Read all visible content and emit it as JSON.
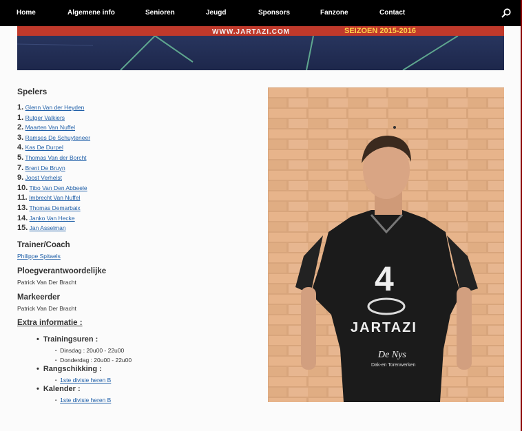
{
  "nav": {
    "items": [
      "Home",
      "Algemene info",
      "Senioren",
      "Jeugd",
      "Sponsors",
      "Fanzone",
      "Contact"
    ],
    "search_icon": "search-icon"
  },
  "banner": {
    "url": "WWW.JARTAZI.COM",
    "season": "SEIZOEN 2015-2016"
  },
  "players": {
    "heading": "Spelers",
    "list": [
      {
        "num": "1.",
        "name": "Glenn Van der Heyden"
      },
      {
        "num": "1.",
        "name": "Rutger Valkiers"
      },
      {
        "num": "2.",
        "name": "Maarten Van Nuffel"
      },
      {
        "num": "3.",
        "name": "Ramses De Schuyteneer"
      },
      {
        "num": "4.",
        "name": "Kas De Durpel"
      },
      {
        "num": "5.",
        "name": "Thomas Van der Borcht"
      },
      {
        "num": "7.",
        "name": "Brent De Bruyn"
      },
      {
        "num": "9.",
        "name": "Joost Verhelst"
      },
      {
        "num": "10.",
        "name": "Tibo Van Den Abbeele"
      },
      {
        "num": "11.",
        "name": "Imbrecht Van Nuffel"
      },
      {
        "num": "13.",
        "name": "Thomas Demarbaix"
      },
      {
        "num": "14.",
        "name": "Janko Van Hecke"
      },
      {
        "num": "15.",
        "name": "Jan Asselman"
      }
    ]
  },
  "trainer": {
    "heading": "Trainer/Coach",
    "name": "Philippe Spitaels"
  },
  "ploeg": {
    "heading": "Ploegverantwoordelijke",
    "name": "Patrick Van Der Bracht"
  },
  "marker": {
    "heading": "Markeerder",
    "name": "Patrick Van Der Bracht"
  },
  "extra": {
    "heading": "Extra informatie :",
    "training_heading": "Trainingsuren :",
    "training": [
      "Dinsdag : 20u00 - 22u00",
      "Donderdag : 20u00 - 22u00"
    ],
    "ranking_heading": "Rangschikking :",
    "ranking_link": "1ste divisie heren B",
    "calendar_heading": "Kalender :",
    "calendar_link": "1ste divisie heren B"
  },
  "photo": {
    "jersey_number": "4",
    "jersey_brand": "JARTAZI",
    "jersey_sponsor": "De Nys",
    "jersey_sponsor_sub": "Dak-en Torenwerken"
  }
}
